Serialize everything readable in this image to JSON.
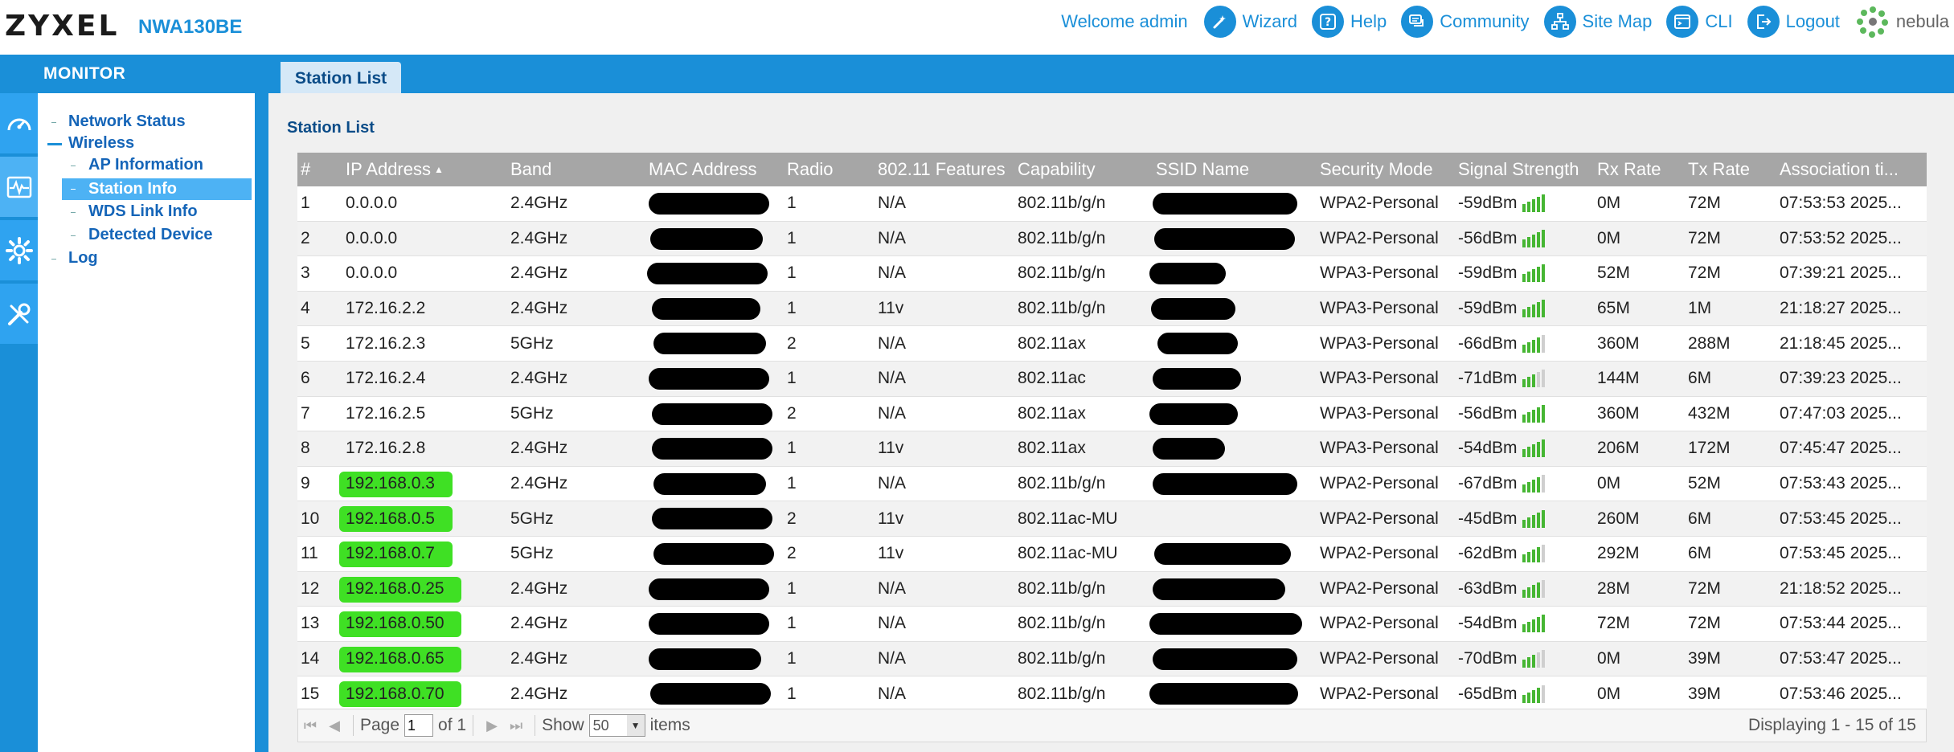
{
  "header": {
    "brand": "ZYXEL",
    "model": "NWA130BE",
    "welcome": "Welcome admin",
    "nav": [
      {
        "label": "Wizard",
        "icon": "wizard-icon"
      },
      {
        "label": "Help",
        "icon": "help-icon"
      },
      {
        "label": "Community",
        "icon": "community-icon"
      },
      {
        "label": "Site Map",
        "icon": "sitemap-icon"
      },
      {
        "label": "CLI",
        "icon": "cli-icon"
      },
      {
        "label": "Logout",
        "icon": "logout-icon"
      }
    ],
    "nebula": "nebula"
  },
  "sidebar": {
    "title": "MONITOR",
    "items": {
      "network_status": "Network Status",
      "wireless": "Wireless",
      "ap_information": "AP Information",
      "station_info": "Station Info",
      "wds_link_info": "WDS Link Info",
      "detected_device": "Detected Device",
      "log": "Log"
    }
  },
  "tabs": {
    "station_list": "Station List"
  },
  "section_title": "Station List",
  "colors": {
    "accent": "#1a8fd8",
    "highlight": "#3fe024",
    "signal": "#46b633"
  },
  "table": {
    "columns": [
      "#",
      "IP Address",
      "Band",
      "MAC Address",
      "Radio",
      "802.11 Features",
      "Capability",
      "SSID Name",
      "Security Mode",
      "Signal Strength",
      "Rx Rate",
      "Tx Rate",
      "Association ti..."
    ],
    "rows": [
      {
        "num": "1",
        "ip": "0.0.0.0",
        "band": "2.4GHz",
        "mac": "",
        "radio": "1",
        "feat": "N/A",
        "cap": "802.11b/g/n",
        "ssid": "",
        "sec": "WPA2-Personal",
        "sig": "-59dBm",
        "bars": 5,
        "rx": "0M",
        "tx": "72M",
        "assoc": "07:53:53 2025..."
      },
      {
        "num": "2",
        "ip": "0.0.0.0",
        "band": "2.4GHz",
        "mac": "",
        "radio": "1",
        "feat": "N/A",
        "cap": "802.11b/g/n",
        "ssid": "",
        "sec": "WPA2-Personal",
        "sig": "-56dBm",
        "bars": 5,
        "rx": "0M",
        "tx": "72M",
        "assoc": "07:53:52 2025..."
      },
      {
        "num": "3",
        "ip": "0.0.0.0",
        "band": "2.4GHz",
        "mac": "",
        "radio": "1",
        "feat": "N/A",
        "cap": "802.11b/g/n",
        "ssid": "",
        "sec": "WPA3-Personal",
        "sig": "-59dBm",
        "bars": 5,
        "rx": "52M",
        "tx": "72M",
        "assoc": "07:39:21 2025..."
      },
      {
        "num": "4",
        "ip": "172.16.2.2",
        "band": "2.4GHz",
        "mac": "",
        "radio": "1",
        "feat": "11v",
        "cap": "802.11b/g/n",
        "ssid": "",
        "sec": "WPA3-Personal",
        "sig": "-59dBm",
        "bars": 5,
        "rx": "65M",
        "tx": "1M",
        "assoc": "21:18:27 2025..."
      },
      {
        "num": "5",
        "ip": "172.16.2.3",
        "band": "5GHz",
        "mac": "",
        "radio": "2",
        "feat": "N/A",
        "cap": "802.11ax",
        "ssid": "",
        "sec": "WPA3-Personal",
        "sig": "-66dBm",
        "bars": 4,
        "rx": "360M",
        "tx": "288M",
        "assoc": "21:18:45 2025..."
      },
      {
        "num": "6",
        "ip": "172.16.2.4",
        "band": "2.4GHz",
        "mac": "",
        "radio": "1",
        "feat": "N/A",
        "cap": "802.11ac",
        "ssid": "",
        "sec": "WPA3-Personal",
        "sig": "-71dBm",
        "bars": 3,
        "rx": "144M",
        "tx": "6M",
        "assoc": "07:39:23 2025..."
      },
      {
        "num": "7",
        "ip": "172.16.2.5",
        "band": "5GHz",
        "mac": "",
        "radio": "2",
        "feat": "N/A",
        "cap": "802.11ax",
        "ssid": "",
        "sec": "WPA3-Personal",
        "sig": "-56dBm",
        "bars": 5,
        "rx": "360M",
        "tx": "432M",
        "assoc": "07:47:03 2025..."
      },
      {
        "num": "8",
        "ip": "172.16.2.8",
        "band": "2.4GHz",
        "mac": "",
        "radio": "1",
        "feat": "11v",
        "cap": "802.11ax",
        "ssid": "",
        "sec": "WPA3-Personal",
        "sig": "-54dBm",
        "bars": 5,
        "rx": "206M",
        "tx": "172M",
        "assoc": "07:45:47 2025..."
      },
      {
        "num": "9",
        "ip": "192.168.0.3",
        "band": "2.4GHz",
        "mac": "",
        "radio": "1",
        "feat": "N/A",
        "cap": "802.11b/g/n",
        "ssid": "",
        "sec": "WPA2-Personal",
        "sig": "-67dBm",
        "bars": 4,
        "rx": "0M",
        "tx": "52M",
        "assoc": "07:53:43 2025..."
      },
      {
        "num": "10",
        "ip": "192.168.0.5",
        "band": "5GHz",
        "mac": "",
        "radio": "2",
        "feat": "11v",
        "cap": "802.11ac-MU",
        "ssid": "",
        "sec": "WPA2-Personal",
        "sig": "-45dBm",
        "bars": 5,
        "rx": "260M",
        "tx": "6M",
        "assoc": "07:53:45 2025..."
      },
      {
        "num": "11",
        "ip": "192.168.0.7",
        "band": "5GHz",
        "mac": "",
        "radio": "2",
        "feat": "11v",
        "cap": "802.11ac-MU",
        "ssid": "",
        "sec": "WPA2-Personal",
        "sig": "-62dBm",
        "bars": 4,
        "rx": "292M",
        "tx": "6M",
        "assoc": "07:53:45 2025..."
      },
      {
        "num": "12",
        "ip": "192.168.0.25",
        "band": "2.4GHz",
        "mac": "",
        "radio": "1",
        "feat": "N/A",
        "cap": "802.11b/g/n",
        "ssid": "",
        "sec": "WPA2-Personal",
        "sig": "-63dBm",
        "bars": 4,
        "rx": "28M",
        "tx": "72M",
        "assoc": "21:18:52 2025..."
      },
      {
        "num": "13",
        "ip": "192.168.0.50",
        "band": "2.4GHz",
        "mac": "",
        "radio": "1",
        "feat": "N/A",
        "cap": "802.11b/g/n",
        "ssid": "",
        "sec": "WPA2-Personal",
        "sig": "-54dBm",
        "bars": 5,
        "rx": "72M",
        "tx": "72M",
        "assoc": "07:53:44 2025..."
      },
      {
        "num": "14",
        "ip": "192.168.0.65",
        "band": "2.4GHz",
        "mac": "",
        "radio": "1",
        "feat": "N/A",
        "cap": "802.11b/g/n",
        "ssid": "",
        "sec": "WPA2-Personal",
        "sig": "-70dBm",
        "bars": 3,
        "rx": "0M",
        "tx": "39M",
        "assoc": "07:53:47 2025..."
      },
      {
        "num": "15",
        "ip": "192.168.0.70",
        "band": "2.4GHz",
        "mac": "",
        "radio": "1",
        "feat": "N/A",
        "cap": "802.11b/g/n",
        "ssid": "",
        "sec": "WPA2-Personal",
        "sig": "-65dBm",
        "bars": 4,
        "rx": "0M",
        "tx": "39M",
        "assoc": "07:53:46 2025..."
      }
    ]
  },
  "pager": {
    "page_label": "Page",
    "page_value": "1",
    "of_label": "of 1",
    "show_label": "Show",
    "show_value": "50",
    "items_label": "items",
    "display_text": "Displaying 1 - 15 of 15"
  }
}
